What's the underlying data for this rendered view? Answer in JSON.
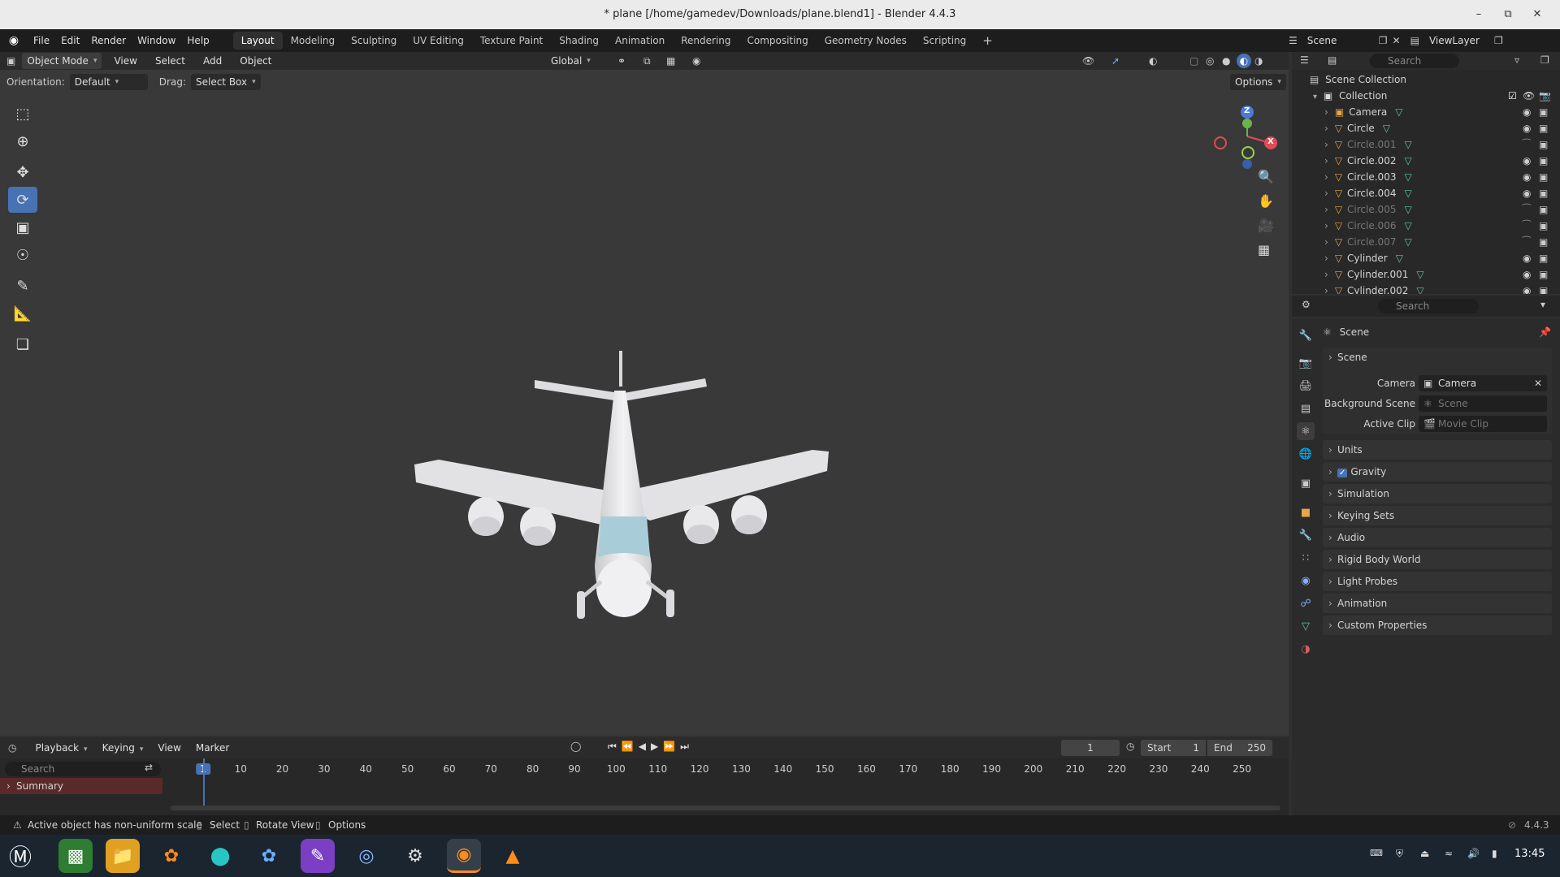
{
  "window": {
    "title": "* plane [/home/gamedev/Downloads/plane.blend1] - Blender 4.4.3"
  },
  "topbar": {
    "menus": [
      "File",
      "Edit",
      "Render",
      "Window",
      "Help"
    ],
    "workspaces": [
      "Layout",
      "Modeling",
      "Sculpting",
      "UV Editing",
      "Texture Paint",
      "Shading",
      "Animation",
      "Rendering",
      "Compositing",
      "Geometry Nodes",
      "Scripting"
    ],
    "active_workspace": "Layout",
    "scene": "Scene",
    "view_layer": "ViewLayer"
  },
  "viewport_header": {
    "mode": "Object Mode",
    "menus": [
      "View",
      "Select",
      "Add",
      "Object"
    ],
    "transform_orientation": "Global",
    "search_placeholder": "Search"
  },
  "tool_settings": {
    "orientation_label": "Orientation:",
    "orientation_value": "Default",
    "drag_label": "Drag:",
    "drag_value": "Select Box",
    "options": "Options"
  },
  "gizmo": {
    "z": "Z",
    "y": "Y",
    "x": "X"
  },
  "outliner": {
    "root": "Scene Collection",
    "collection": "Collection",
    "items": [
      {
        "name": "Camera",
        "dim": false
      },
      {
        "name": "Circle",
        "dim": false
      },
      {
        "name": "Circle.001",
        "dim": true
      },
      {
        "name": "Circle.002",
        "dim": false
      },
      {
        "name": "Circle.003",
        "dim": false
      },
      {
        "name": "Circle.004",
        "dim": false
      },
      {
        "name": "Circle.005",
        "dim": true
      },
      {
        "name": "Circle.006",
        "dim": true
      },
      {
        "name": "Circle.007",
        "dim": true
      },
      {
        "name": "Cylinder",
        "dim": false
      },
      {
        "name": "Cylinder.001",
        "dim": false
      },
      {
        "name": "Cylinder.002",
        "dim": false
      }
    ]
  },
  "properties": {
    "search_placeholder": "Search",
    "context": "Scene",
    "panel_title": "Scene",
    "camera_label": "Camera",
    "camera_value": "Camera",
    "background_scene_label": "Background Scene",
    "background_scene_placeholder": "Scene",
    "active_clip_label": "Active Clip",
    "active_clip_placeholder": "Movie Clip",
    "panels": [
      "Units",
      "Gravity",
      "Simulation",
      "Keying Sets",
      "Audio",
      "Rigid Body World",
      "Light Probes",
      "Animation",
      "Custom Properties"
    ]
  },
  "timeline": {
    "menus": [
      "Playback",
      "Keying",
      "View",
      "Marker"
    ],
    "current_frame": "1",
    "start_label": "Start",
    "start": "1",
    "end_label": "End",
    "end": "250",
    "search_placeholder": "Search",
    "summary": "Summary",
    "ticks": [
      "1",
      "10",
      "20",
      "30",
      "40",
      "50",
      "60",
      "70",
      "80",
      "90",
      "100",
      "110",
      "120",
      "130",
      "140",
      "150",
      "160",
      "170",
      "180",
      "190",
      "200",
      "210",
      "220",
      "230",
      "240",
      "250"
    ]
  },
  "statusbar": {
    "warning": "Active object has non-uniform scale",
    "select": "Select",
    "rotate_view": "Rotate View",
    "options": "Options",
    "version": "4.4.3"
  },
  "taskbar": {
    "clock": "13:45"
  },
  "colors": {
    "accent": "#4772b3",
    "selected_row": "#334d80",
    "object_orange": "#e8a54a",
    "mesh_green": "#5ac8a0"
  }
}
